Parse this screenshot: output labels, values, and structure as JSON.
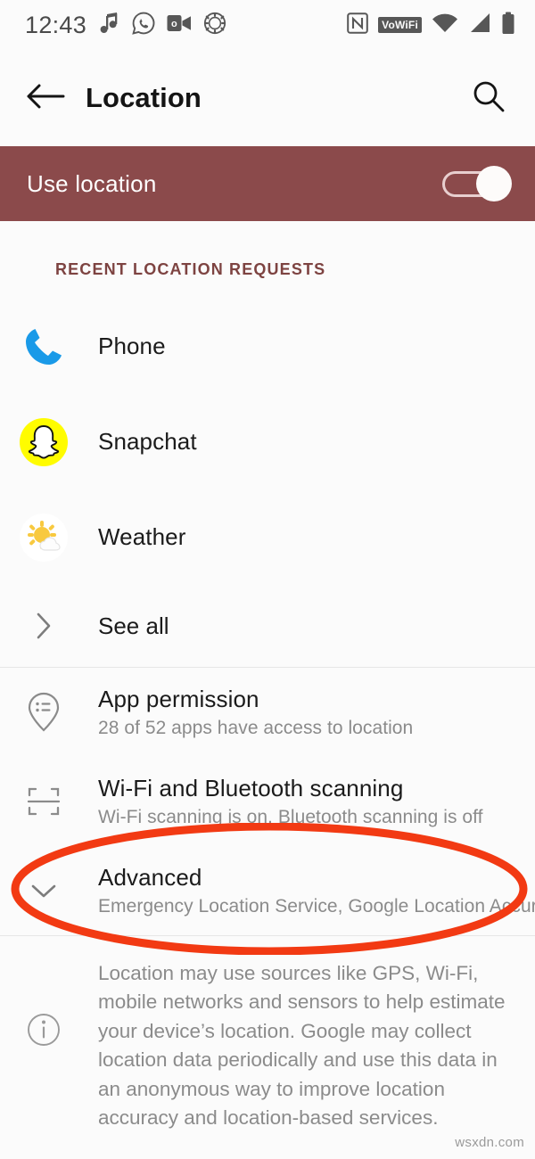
{
  "statusbar": {
    "clock": "12:43",
    "left_icons": [
      "music-note-icon",
      "whatsapp-icon",
      "outlook-video-icon",
      "camera-shutter-icon"
    ],
    "right_icons": [
      "nfc-icon",
      "vowifi-badge",
      "wifi-icon",
      "cellular-signal-icon",
      "battery-icon"
    ],
    "vowifi_label": "VoWiFi"
  },
  "appbar": {
    "back_icon": "arrow-left-icon",
    "title": "Location",
    "search_icon": "search-icon"
  },
  "banner": {
    "label": "Use location",
    "toggle_state": "on",
    "background_color": "#8b4a4b"
  },
  "section": {
    "header": "RECENT LOCATION REQUESTS",
    "header_color": "#7d4341"
  },
  "recent_apps": [
    {
      "label": "Phone",
      "icon": "phone-handset-icon",
      "color": "#1a9ae8"
    },
    {
      "label": "Snapchat",
      "icon": "snapchat-ghost-icon",
      "color": "#fffc00"
    },
    {
      "label": "Weather",
      "icon": "weather-sun-cloud-icon",
      "color": "#f6c945"
    }
  ],
  "see_all": {
    "label": "See all",
    "icon": "chevron-right-icon"
  },
  "settings": [
    {
      "title": "App permission",
      "subtitle": "28 of 52 apps have access to location",
      "icon": "location-pin-list-icon"
    },
    {
      "title": "Wi-Fi and Bluetooth scanning",
      "subtitle": "Wi-Fi scanning is on, Bluetooth scanning is off",
      "icon": "scan-frame-icon"
    },
    {
      "title": "Advanced",
      "subtitle": "Emergency Location Service, Google Location Accurac··",
      "icon": "chevron-down-icon"
    }
  ],
  "footer": {
    "icon": "info-icon",
    "text": "Location may use sources like GPS, Wi-Fi, mobile networks and sensors to help estimate your device’s location. Google may collect location data periodically and use this data in an anonymous way to improve location accuracy and location-based services."
  },
  "annotation": {
    "shape": "ellipse",
    "color": "#f23a13",
    "targets": "Advanced"
  },
  "watermark": "wsxdn.com"
}
